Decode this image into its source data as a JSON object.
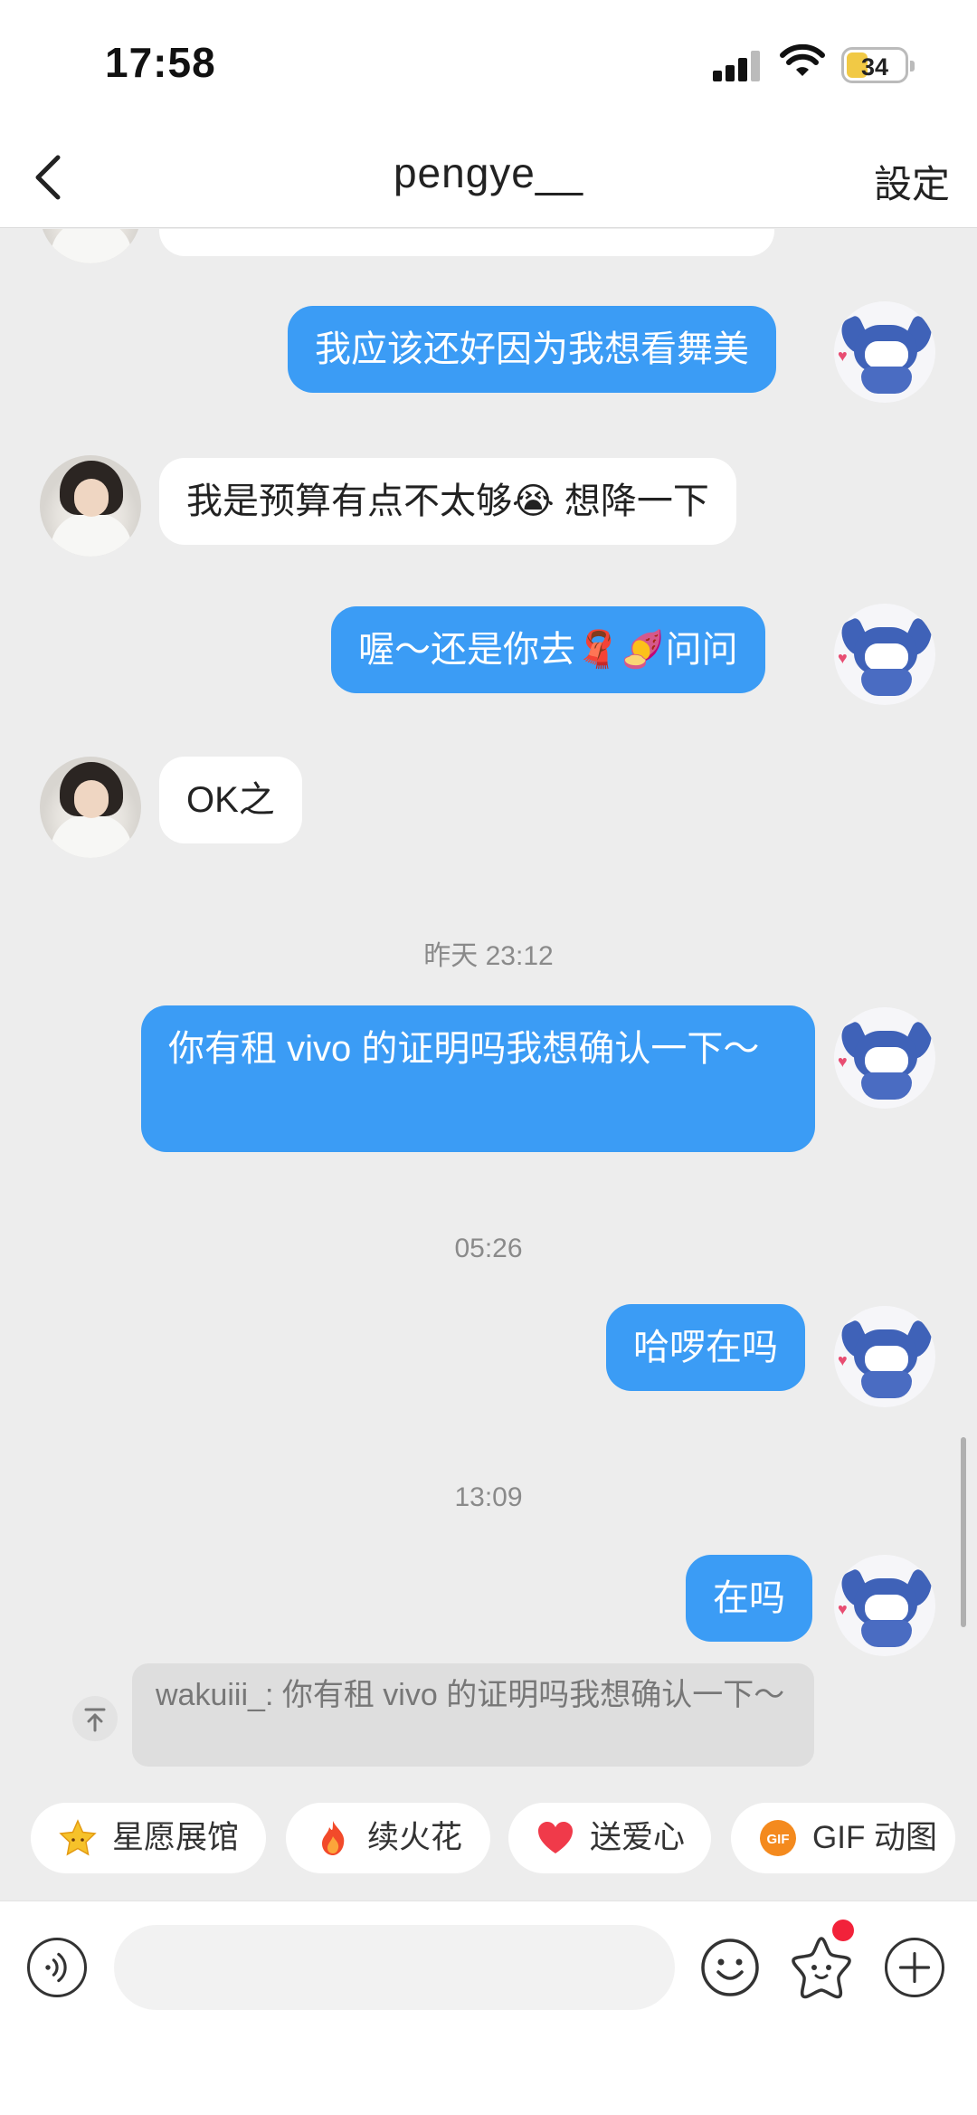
{
  "status": {
    "time": "17:58",
    "battery": "34"
  },
  "header": {
    "title": "pengye__",
    "settings_label": "設定"
  },
  "messages": [
    {
      "text": "我应该还好因为我想看舞美"
    },
    {
      "text": "我是预算有点不太够😭 想降一下"
    },
    {
      "text": "喔～还是你去🧣🍠问问"
    },
    {
      "text": "OK之"
    },
    {
      "text": "你有租 vivo 的证明吗我想确认一下～"
    },
    {
      "text": "哈啰在吗"
    },
    {
      "text": "在吗"
    }
  ],
  "timestamps": [
    "昨天 23:12",
    "05:26",
    "13:09"
  ],
  "reply_quote": {
    "text": "wakuiii_: 你有租 vivo 的证明吗我想确认一下～"
  },
  "actions": [
    {
      "label": "星愿展馆",
      "icon": "star-icon"
    },
    {
      "label": "续火花",
      "icon": "fire-icon"
    },
    {
      "label": "送爱心",
      "icon": "heart-icon"
    },
    {
      "label": "GIF 动图",
      "icon": "gif-icon"
    }
  ],
  "input": {
    "placeholder": ""
  },
  "colors": {
    "outgoing_bubble": "#3b9cf5",
    "incoming_bubble": "#ffffff",
    "background": "#ededed"
  }
}
